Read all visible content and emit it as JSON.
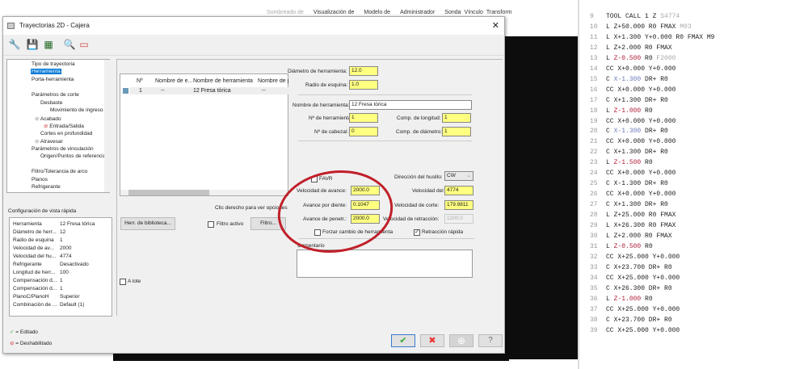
{
  "ribbon": [
    "Sombreado de",
    "Visualización de",
    "Modelo de",
    "Administrador",
    "Sonda",
    "Vínculo",
    "Transform"
  ],
  "dialog": {
    "title": "Trayectorias 2D - Cajera",
    "tree": [
      "Tipo de trayectoria",
      "Herramienta",
      "Porta-herramienta",
      "Parámetros de corte",
      "Desbaste",
      "Movimiento de ingreso",
      "Acabado",
      "Entrada/Salida",
      "Cortes en profundidad",
      "Atravesar",
      "Parámetros de vinculación",
      "Origen/Puntos de referencia",
      "Filtro/Tolerancia de arco",
      "Planos",
      "Refrigerante"
    ],
    "quick_view": {
      "title": "Configuración de vista rápida",
      "rows": [
        [
          "Herramienta",
          "12 Fresa tórica"
        ],
        [
          "Diámetro de herr...",
          "12"
        ],
        [
          "Radio de esquina",
          "1"
        ],
        [
          "Velocidad de av...",
          "2000"
        ],
        [
          "Velocidad del hu...",
          "4774"
        ],
        [
          "Refrigerante",
          "Desactivado"
        ],
        [
          "Longitud de herr...",
          "100"
        ],
        [
          "Compensación d...",
          "1"
        ],
        [
          "Compensación d...",
          "1"
        ],
        [
          "PlanoC/PlanoH",
          "Superior"
        ],
        [
          "Combinación de ...",
          "Default (1)"
        ]
      ]
    },
    "legend": {
      "edited": "= Editado",
      "disabled": "= Deshabilitado"
    },
    "table": {
      "headers": [
        "Nº",
        "Nombre de e...",
        "Nombre de herramienta",
        "Nombre de p"
      ],
      "rows": [
        [
          "1",
          "--",
          "12 Fresa tórica",
          "--"
        ]
      ]
    },
    "hint": "Clic derecho para ver opciones",
    "library_btn": "Herr. de biblioteca...",
    "filter_active": "Filtro activo",
    "filter_btn": "Filtro...",
    "batch": "A lote",
    "fields": {
      "diam_label": "Diámetro de herramienta:",
      "diam": "12.0",
      "radius_label": "Radio de esquina:",
      "radius": "1.0",
      "name_label": "Nombre de herramienta:",
      "name": "12 Fresa tórica",
      "tool_no_label": "Nº de herramienta:",
      "tool_no": "1",
      "head_no_label": "Nº de cabezal:",
      "head_no": "0",
      "len_comp_label": "Comp. de longitud:",
      "len_comp": "1",
      "diam_comp_label": "Comp. de diámetro:",
      "diam_comp": "1",
      "favr": "FAVR",
      "spindle_dir_label": "Dirección del husillo:",
      "spindle_dir": "CW",
      "feed_label": "Velocidad de avance:",
      "feed": "2000.0",
      "spindle_label": "Velocidad del",
      "spindle": "4774",
      "fpt_label": "Avance por diente:",
      "fpt": "0.1047",
      "cut_speed_label": "Velocidad de corte:",
      "cut_speed": "179.9811",
      "plunge_label": "Avance de penetr.:",
      "plunge": "2000.0",
      "retract_label": "Velocidad de retracción:",
      "retract": "1200.0",
      "force_change": "Forzar cambio de herramienta",
      "rapid_retract": "Retracción rápida",
      "comment_label": "Comentario"
    }
  },
  "code": [
    {
      "n": "9",
      "p": [
        [
          "TOOL CALL 1 Z ",
          ""
        ],
        [
          "S4774",
          "g"
        ]
      ]
    },
    {
      "n": "10",
      "p": [
        [
          "L Z+50.000 R0 FMAX ",
          ""
        ],
        [
          "M03",
          "g"
        ]
      ]
    },
    {
      "n": "11",
      "p": [
        [
          "L X+1.300 Y+0.000 R0 FMAX M9",
          ""
        ]
      ]
    },
    {
      "n": "12",
      "p": [
        [
          "L Z+2.000 R0 FMAX",
          ""
        ]
      ]
    },
    {
      "n": "13",
      "p": [
        [
          "L ",
          ""
        ],
        [
          "Z-0.500",
          "r"
        ],
        [
          " R0 ",
          ""
        ],
        [
          "F2000",
          "g"
        ]
      ]
    },
    {
      "n": "14",
      "p": [
        [
          "CC X+0.000 Y+0.000",
          ""
        ]
      ]
    },
    {
      "n": "15",
      "p": [
        [
          "C ",
          ""
        ],
        [
          "X-1.300",
          "b"
        ],
        [
          " DR+ R0",
          ""
        ]
      ]
    },
    {
      "n": "16",
      "p": [
        [
          "CC X+0.000 Y+0.000",
          ""
        ]
      ]
    },
    {
      "n": "17",
      "p": [
        [
          "C X+1.300 DR+ R0",
          ""
        ]
      ]
    },
    {
      "n": "18",
      "p": [
        [
          "L ",
          ""
        ],
        [
          "Z-1.000",
          "r"
        ],
        [
          " R0",
          ""
        ]
      ]
    },
    {
      "n": "19",
      "p": [
        [
          "CC X+0.000 Y+0.000",
          ""
        ]
      ]
    },
    {
      "n": "20",
      "p": [
        [
          "C ",
          ""
        ],
        [
          "X-1.300",
          "b"
        ],
        [
          " DR+ R0",
          ""
        ]
      ]
    },
    {
      "n": "21",
      "p": [
        [
          "CC X+0.000 Y+0.000",
          ""
        ]
      ]
    },
    {
      "n": "22",
      "p": [
        [
          "C X+1.300 DR+ R0",
          ""
        ]
      ]
    },
    {
      "n": "23",
      "p": [
        [
          "L ",
          ""
        ],
        [
          "Z-1.500",
          "r"
        ],
        [
          " R0",
          ""
        ]
      ]
    },
    {
      "n": "24",
      "p": [
        [
          "CC X+0.000 Y+0.000",
          ""
        ]
      ]
    },
    {
      "n": "25",
      "p": [
        [
          "C X-1.300 DR+ R0",
          ""
        ]
      ]
    },
    {
      "n": "26",
      "p": [
        [
          "CC X+0.000 Y+0.000",
          ""
        ]
      ]
    },
    {
      "n": "27",
      "p": [
        [
          "C X+1.300 DR+ R0",
          ""
        ]
      ]
    },
    {
      "n": "28",
      "p": [
        [
          "L Z+25.000 R0 FMAX",
          ""
        ]
      ]
    },
    {
      "n": "29",
      "p": [
        [
          "L X+26.300 R0 FMAX",
          ""
        ]
      ]
    },
    {
      "n": "30",
      "p": [
        [
          "L Z+2.000 R0 FMAX",
          ""
        ]
      ]
    },
    {
      "n": "31",
      "p": [
        [
          "L ",
          ""
        ],
        [
          "Z-0.500",
          "r"
        ],
        [
          " R0",
          ""
        ]
      ]
    },
    {
      "n": "32",
      "p": [
        [
          "CC X+25.000 Y+0.000",
          ""
        ]
      ]
    },
    {
      "n": "33",
      "p": [
        [
          "C X+23.700 DR+ R0",
          ""
        ]
      ]
    },
    {
      "n": "34",
      "p": [
        [
          "CC X+25.000 Y+0.000",
          ""
        ]
      ]
    },
    {
      "n": "35",
      "p": [
        [
          "C X+26.300 DR+ R0",
          ""
        ]
      ]
    },
    {
      "n": "36",
      "p": [
        [
          "L ",
          ""
        ],
        [
          "Z-1.000",
          "r"
        ],
        [
          " R0",
          ""
        ]
      ]
    },
    {
      "n": "37",
      "p": [
        [
          "CC X+25.000 Y+0.000",
          ""
        ]
      ]
    },
    {
      "n": "38",
      "p": [
        [
          "C X+23.700 DR+ R0",
          ""
        ]
      ]
    },
    {
      "n": "39",
      "p": [
        [
          "CC X+25.000 Y+0.000",
          ""
        ]
      ]
    }
  ]
}
